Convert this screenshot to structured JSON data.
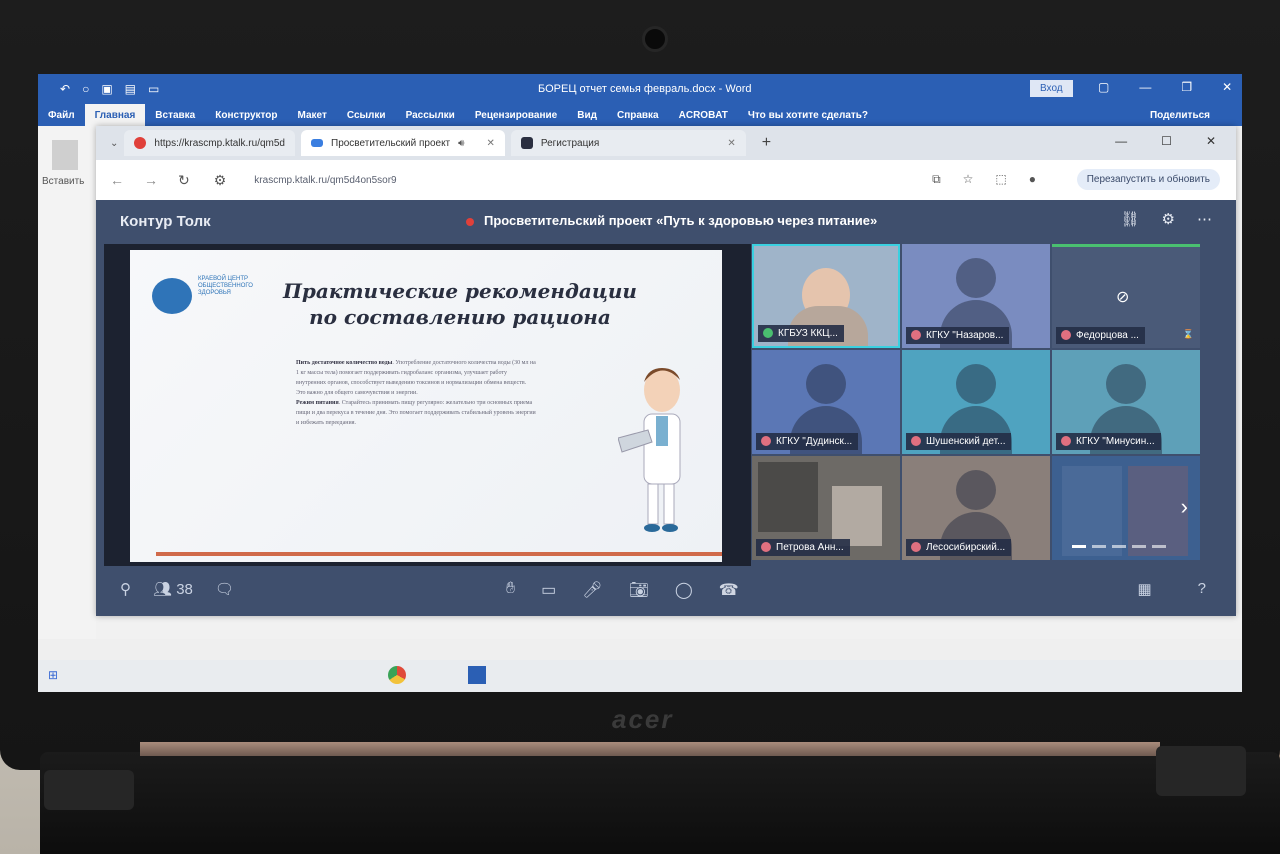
{
  "word": {
    "doc_title": "БОРЕЦ  отчет семья  февраль.docx  -  Word",
    "login": "Вход",
    "share": "Поделиться",
    "tell_me": "Что вы хотите сделать?",
    "ribbon_tabs": [
      "Файл",
      "Главная",
      "Вставка",
      "Конструктор",
      "Макет",
      "Ссылки",
      "Рассылки",
      "Рецензирование",
      "Вид",
      "Справка",
      "ACROBAT"
    ],
    "side_label": "Вставить"
  },
  "browser": {
    "tabs": [
      {
        "label": "https://krascmp.ktalk.ru/qm5d",
        "fav_color": "#e0403a"
      },
      {
        "label": "Просветительский проект",
        "fav_color": "#3a7ee0"
      },
      {
        "label": "Регистрация",
        "fav_color": "#2a2f40"
      }
    ],
    "url": "krascmp.ktalk.ru/qm5d4on5sor9",
    "relaunch": "Перезапустить и обновить"
  },
  "talk": {
    "app_name": "Контур Толк",
    "meeting_title": "Просветительский проект «Путь к здоровью через питание»",
    "participant_count": "38",
    "participants": [
      {
        "name": "КГБУЗ ККЦ...",
        "bg": "#9fb4c9",
        "speaker": true
      },
      {
        "name": "КГКУ \"Назаров...",
        "bg": "#7a8cc0"
      },
      {
        "name": "Федорцова ...",
        "bg": "#4a5a78",
        "cam_off": true
      },
      {
        "name": "КГКУ \"Дудинск...",
        "bg": "#5b77b5"
      },
      {
        "name": "Шушенский дет...",
        "bg": "#4fa3c0"
      },
      {
        "name": "КГКУ \"Минусин...",
        "bg": "#5ea0b8"
      },
      {
        "name": "Петрова Анн...",
        "bg": "#6d6a66"
      },
      {
        "name": "Лесосибирский...",
        "bg": "#8a7f7a"
      },
      {
        "name": "",
        "bg": "#3d6090",
        "more": true
      }
    ]
  },
  "slide": {
    "heading_line1": "Практические рекомендации",
    "heading_line2": "по составлению рациона",
    "logo_text": "КРАЕВОЙ ЦЕНТР ОБЩЕСТВЕННОГО ЗДОРОВЬЯ",
    "p1_lead": "Пить достаточное количество воды",
    "p1": "Употребление достаточного количества воды (30 мл на 1 кг массы тела) помогает поддерживать гидробаланс организма, улучшает работу внутренних органов, способствует выведению токсинов и нормализации обмена веществ. Это важно для общего самочувствия и энергии.",
    "p2_lead": "Режим питания",
    "p2": "Старайтесь принимать пищу регулярно: желательно три основных приема пищи и два перекуса в течение дня. Это помогает поддерживать стабильный уровень энергии и избежать переедания."
  }
}
